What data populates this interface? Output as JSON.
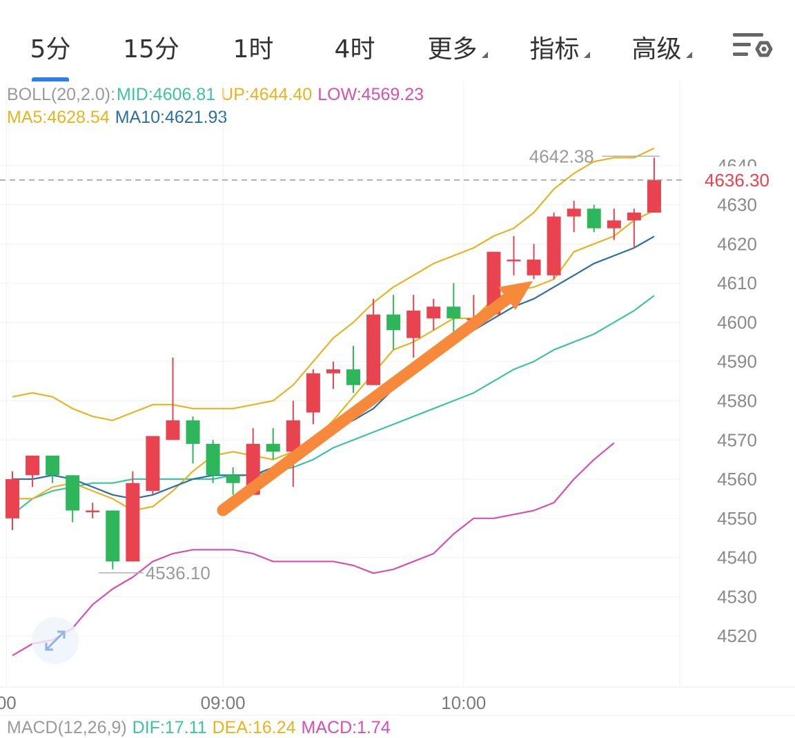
{
  "tabs": [
    {
      "label": "5分",
      "active": true,
      "caret": false
    },
    {
      "label": "15分",
      "active": false,
      "caret": false
    },
    {
      "label": "1时",
      "active": false,
      "caret": false
    },
    {
      "label": "4时",
      "active": false,
      "caret": false
    },
    {
      "label": "更多",
      "active": false,
      "caret": true
    },
    {
      "label": "指标",
      "active": false,
      "caret": true
    },
    {
      "label": "高级",
      "active": false,
      "caret": true
    }
  ],
  "settings_icon": "chart-settings-icon",
  "indicators": {
    "boll_label": "BOLL(20,2.0):",
    "mid": "MID:4606.81",
    "up": "UP:4644.40",
    "low": "LOW:4569.23",
    "ma5": "MA5:4628.54",
    "ma10": "MA10:4621.93"
  },
  "macd": {
    "label": "MACD(12,26,9)",
    "dif": "DIF:17.11",
    "dea": "DEA:16.24",
    "macd": "MACD:1.74"
  },
  "colors": {
    "up": "#e8434f",
    "down": "#2eb65a",
    "boll_up": "#e8b41e",
    "boll_mid": "#3cc3a4",
    "boll_low": "#d64fb2",
    "ma5": "#e8b41e",
    "ma10": "#2b6ea6",
    "arrow": "#f7893a",
    "accent": "#2f7fe8",
    "current_price_label": "#e8434f"
  },
  "chart_data": {
    "type": "candlestick",
    "interval": "5分",
    "x_labels": [
      {
        "i": -0.3,
        "label": "00"
      },
      {
        "i": 10.5,
        "label": "09:00"
      },
      {
        "i": 22.5,
        "label": "10:00"
      }
    ],
    "y_ticks": [
      4520,
      4530,
      4540,
      4550,
      4560,
      4570,
      4580,
      4590,
      4600,
      4610,
      4620,
      4630,
      4640
    ],
    "ylim": [
      4507,
      4650
    ],
    "current_price": "4636.30",
    "high_label": {
      "i": 29,
      "value": 4642.38,
      "label": "4642.38"
    },
    "low_label": {
      "i": 5.5,
      "value": 4536.1,
      "label": "4536.10"
    },
    "candles": [
      [
        4550,
        4562,
        4560,
        4547
      ],
      [
        4561,
        4566,
        4566,
        4558
      ],
      [
        4566,
        4566,
        4561,
        4559
      ],
      [
        4561,
        4561,
        4552,
        4549
      ],
      [
        4552,
        4554,
        4552,
        4550
      ],
      [
        4552,
        4552,
        4539,
        4537
      ],
      [
        4539,
        4562,
        4559,
        4539
      ],
      [
        4557,
        4571,
        4571,
        4556
      ],
      [
        4570,
        4591,
        4575,
        4570
      ],
      [
        4575,
        4576,
        4569,
        4564
      ],
      [
        4569,
        4570,
        4561,
        4559
      ],
      [
        4561,
        4563,
        4559,
        4556
      ],
      [
        4556,
        4573,
        4569,
        4556
      ],
      [
        4569,
        4573,
        4567,
        4565
      ],
      [
        4567,
        4580,
        4575,
        4558
      ],
      [
        4577,
        4588,
        4587,
        4574
      ],
      [
        4587,
        4590,
        4588,
        4583
      ],
      [
        4588,
        4594,
        4584,
        4582
      ],
      [
        4584,
        4606,
        4602,
        4584
      ],
      [
        4602,
        4607,
        4598,
        4593
      ],
      [
        4596,
        4607,
        4603,
        4591
      ],
      [
        4601,
        4606,
        4604,
        4598
      ],
      [
        4604,
        4610,
        4601,
        4597
      ],
      [
        4601,
        4607,
        4601,
        4600
      ],
      [
        4602,
        4618,
        4618,
        4602
      ],
      [
        4616,
        4622,
        4616,
        4612
      ],
      [
        4612,
        4620,
        4616,
        4611
      ],
      [
        4612,
        4628,
        4627,
        4611
      ],
      [
        4627,
        4631,
        4629,
        4623
      ],
      [
        4629,
        4630,
        4624,
        4623
      ],
      [
        4624,
        4629,
        4626,
        4621
      ],
      [
        4626,
        4629,
        4628,
        4619
      ],
      [
        4628,
        4642,
        4636.3,
        4628
      ]
    ],
    "series": [
      {
        "name": "UP",
        "color": "#e8b41e",
        "values": [
          4581,
          4582,
          4581,
          4578,
          4576,
          4575,
          4577,
          4579,
          4579,
          4578,
          4578,
          4578,
          4579,
          4580,
          4584,
          4590,
          4596,
          4600,
          4605,
          4609,
          4612,
          4615,
          4617,
          4619,
          4622,
          4624,
          4628,
          4634,
          4638,
          4641,
          4642,
          4642,
          4644.4
        ]
      },
      {
        "name": "MID",
        "color": "#3cc3a4",
        "values": [
          4551,
          4555,
          4557,
          4558,
          4559,
          4559,
          4560,
          4560,
          4560,
          4560,
          4560,
          4561,
          4561,
          4562,
          4563,
          4565,
          4568,
          4570,
          4572,
          4574,
          4576,
          4578,
          4580,
          4582,
          4585,
          4588,
          4590,
          4593,
          4595,
          4597,
          4600,
          4603,
          4606.81
        ]
      },
      {
        "name": "LOW",
        "color": "#d64fb2",
        "values": [
          4515,
          4518,
          4519,
          4522,
          4528,
          4532,
          4535,
          4539,
          4541,
          4542,
          4542,
          4542,
          4541,
          4539,
          4539,
          4539,
          4539,
          4538,
          4536,
          4537,
          4539,
          4541,
          4546,
          4550,
          4550,
          4551,
          4552,
          4554,
          4560,
          4565,
          4569.23
        ]
      },
      {
        "name": "MA5",
        "color": "#e8b41e",
        "values": [
          4555,
          4555,
          4558,
          4559,
          4557,
          4555,
          4552,
          4553,
          4557,
          4562,
          4566,
          4567,
          4566,
          4565,
          4567,
          4570,
          4575,
          4581,
          4587,
          4593,
          4595,
          4598,
          4601,
          4601,
          4606,
          4608,
          4609,
          4611,
          4618,
          4620,
          4622,
          4626,
          4628.54
        ]
      },
      {
        "name": "MA10",
        "color": "#2b6ea6",
        "values": [
          4560,
          4560,
          4561,
          4560,
          4558,
          4556,
          4555,
          4556,
          4558,
          4560,
          4561,
          4561,
          4561,
          4563,
          4566,
          4570,
          4573,
          4575,
          4578,
          4583,
          4587,
          4591,
          4595,
          4598,
          4601,
          4604,
          4606,
          4609,
          4612,
          4615,
          4617,
          4619,
          4621.93
        ]
      }
    ]
  }
}
